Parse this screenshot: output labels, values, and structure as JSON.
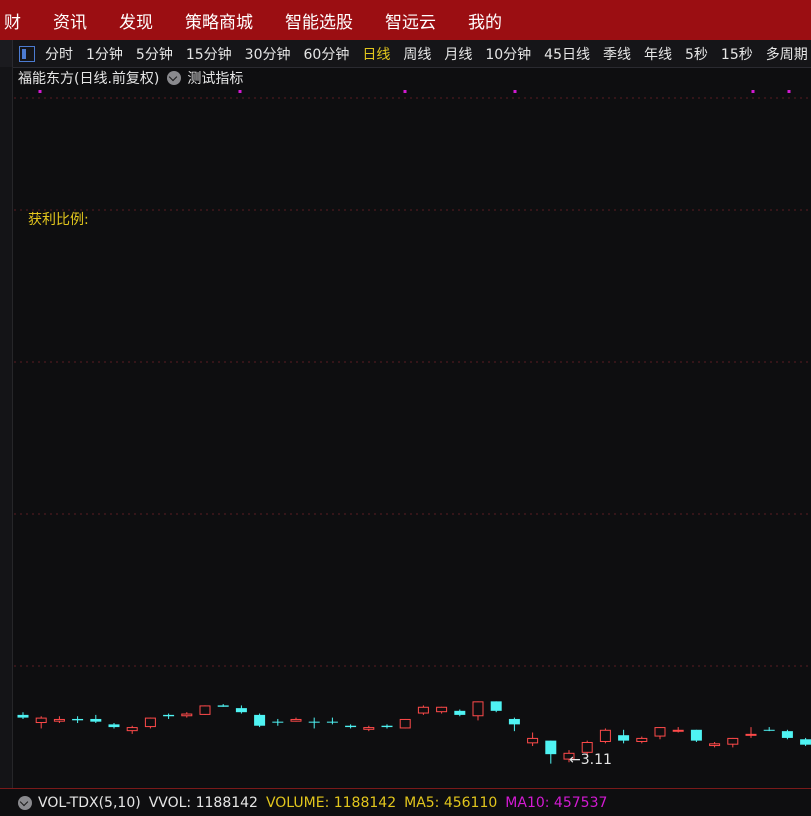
{
  "top_menu": [
    "财",
    "资讯",
    "发现",
    "策略商城",
    "智能选股",
    "智远云",
    "我的"
  ],
  "periods": [
    "分时",
    "1分钟",
    "5分钟",
    "15分钟",
    "30分钟",
    "60分钟",
    "日线",
    "周线",
    "月线",
    "10分钟",
    "45日线",
    "季线",
    "年线",
    "5秒",
    "15秒",
    "多周期"
  ],
  "active_period": "日线",
  "chart": {
    "title": "福能东方(日线.前复权)",
    "indicator": "测试指标",
    "profit_label": "获利比例:",
    "low_marker": "←3.11"
  },
  "volume_bar": {
    "name": "VOL-TDX(5,10)",
    "vvol": "VVOL: 1188142",
    "volume": "VOLUME: 1188142",
    "ma5": "MA5: 456110",
    "ma10": "MA10: 457537"
  },
  "colors": {
    "up": "#ff4a4a",
    "down": "#4ff3f3",
    "yellow": "#e2c61d",
    "magenta": "#d21ad2",
    "menu_bg": "#9b0e12"
  },
  "chart_data": {
    "type": "candlestick",
    "low_value": 3.11,
    "candles": [
      {
        "d": "down",
        "o": 3.55,
        "c": 3.53,
        "h": 3.57,
        "l": 3.52
      },
      {
        "d": "up",
        "o": 3.49,
        "c": 3.53,
        "h": 3.54,
        "l": 3.45
      },
      {
        "d": "up",
        "o": 3.5,
        "c": 3.52,
        "h": 3.54,
        "l": 3.49
      },
      {
        "d": "down",
        "o": 3.52,
        "c": 3.51,
        "h": 3.54,
        "l": 3.49
      },
      {
        "d": "down",
        "o": 3.52,
        "c": 3.5,
        "h": 3.55,
        "l": 3.49
      },
      {
        "d": "down",
        "o": 3.48,
        "c": 3.46,
        "h": 3.49,
        "l": 3.45
      },
      {
        "d": "up",
        "o": 3.43,
        "c": 3.46,
        "h": 3.47,
        "l": 3.41
      },
      {
        "d": "up",
        "o": 3.46,
        "c": 3.53,
        "h": 3.53,
        "l": 3.45
      },
      {
        "d": "down",
        "o": 3.55,
        "c": 3.54,
        "h": 3.56,
        "l": 3.52
      },
      {
        "d": "up",
        "o": 3.54,
        "c": 3.56,
        "h": 3.57,
        "l": 3.53
      },
      {
        "d": "up",
        "o": 3.55,
        "c": 3.62,
        "h": 3.62,
        "l": 3.55
      },
      {
        "d": "down",
        "o": 3.62,
        "c": 3.61,
        "h": 3.63,
        "l": 3.61
      },
      {
        "d": "down",
        "o": 3.6,
        "c": 3.57,
        "h": 3.62,
        "l": 3.56
      },
      {
        "d": "down",
        "o": 3.55,
        "c": 3.47,
        "h": 3.56,
        "l": 3.46
      },
      {
        "d": "down",
        "o": 3.5,
        "c": 3.5,
        "h": 3.52,
        "l": 3.47
      },
      {
        "d": "up",
        "o": 3.5,
        "c": 3.52,
        "h": 3.53,
        "l": 3.5
      },
      {
        "d": "down",
        "o": 3.5,
        "c": 3.5,
        "h": 3.53,
        "l": 3.45
      },
      {
        "d": "down",
        "o": 3.5,
        "c": 3.5,
        "h": 3.53,
        "l": 3.48
      },
      {
        "d": "down",
        "o": 3.47,
        "c": 3.46,
        "h": 3.48,
        "l": 3.45
      },
      {
        "d": "up",
        "o": 3.44,
        "c": 3.46,
        "h": 3.47,
        "l": 3.43
      },
      {
        "d": "down",
        "o": 3.47,
        "c": 3.46,
        "h": 3.48,
        "l": 3.45
      },
      {
        "d": "up",
        "o": 3.45,
        "c": 3.52,
        "h": 3.52,
        "l": 3.45
      },
      {
        "d": "up",
        "o": 3.56,
        "c": 3.61,
        "h": 3.62,
        "l": 3.55
      },
      {
        "d": "up",
        "o": 3.57,
        "c": 3.61,
        "h": 3.61,
        "l": 3.56
      },
      {
        "d": "down",
        "o": 3.58,
        "c": 3.55,
        "h": 3.59,
        "l": 3.54
      },
      {
        "d": "up",
        "o": 3.54,
        "c": 3.65,
        "h": 3.65,
        "l": 3.51
      },
      {
        "d": "down",
        "o": 3.65,
        "c": 3.58,
        "h": 3.65,
        "l": 3.57
      },
      {
        "d": "down",
        "o": 3.52,
        "c": 3.48,
        "h": 3.53,
        "l": 3.43
      },
      {
        "d": "up",
        "o": 3.34,
        "c": 3.38,
        "h": 3.42,
        "l": 3.32
      },
      {
        "d": "down",
        "o": 3.36,
        "c": 3.26,
        "h": 3.36,
        "l": 3.19
      },
      {
        "d": "up",
        "o": 3.22,
        "c": 3.27,
        "h": 3.29,
        "l": 3.2
      },
      {
        "d": "up",
        "o": 3.27,
        "c": 3.35,
        "h": 3.36,
        "l": 3.25
      },
      {
        "d": "up",
        "o": 3.35,
        "c": 3.44,
        "h": 3.45,
        "l": 3.34
      },
      {
        "d": "down",
        "o": 3.4,
        "c": 3.36,
        "h": 3.44,
        "l": 3.34
      },
      {
        "d": "up",
        "o": 3.35,
        "c": 3.38,
        "h": 3.39,
        "l": 3.34
      },
      {
        "d": "up",
        "o": 3.39,
        "c": 3.46,
        "h": 3.46,
        "l": 3.37
      },
      {
        "d": "up",
        "o": 3.43,
        "c": 3.44,
        "h": 3.46,
        "l": 3.42
      },
      {
        "d": "down",
        "o": 3.44,
        "c": 3.36,
        "h": 3.44,
        "l": 3.35
      },
      {
        "d": "up",
        "o": 3.32,
        "c": 3.34,
        "h": 3.35,
        "l": 3.31
      },
      {
        "d": "up",
        "o": 3.33,
        "c": 3.38,
        "h": 3.38,
        "l": 3.31
      },
      {
        "d": "up",
        "o": 3.4,
        "c": 3.41,
        "h": 3.46,
        "l": 3.38
      },
      {
        "d": "down",
        "o": 3.44,
        "c": 3.44,
        "h": 3.46,
        "l": 3.43
      },
      {
        "d": "down",
        "o": 3.43,
        "c": 3.38,
        "h": 3.44,
        "l": 3.37
      },
      {
        "d": "down",
        "o": 3.37,
        "c": 3.33,
        "h": 3.38,
        "l": 3.32
      }
    ]
  }
}
